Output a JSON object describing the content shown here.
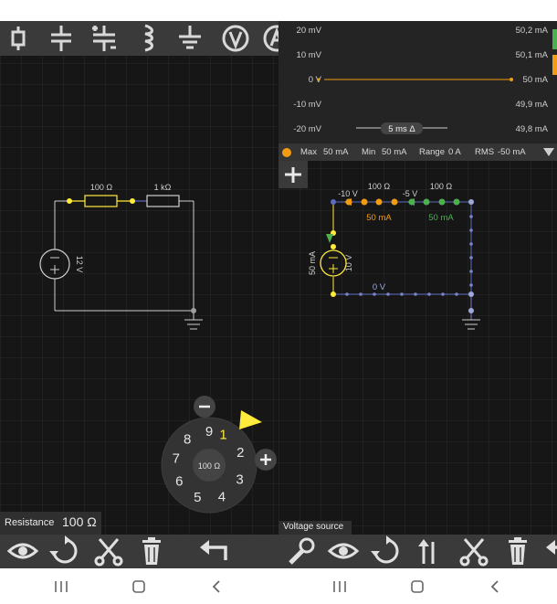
{
  "left": {
    "toolbar_icons": [
      "resistor-icon",
      "capacitor-icon",
      "polarized-capacitor-icon",
      "inductor-icon",
      "ground-icon",
      "voltmeter-icon",
      "ammeter-icon"
    ],
    "circuit": {
      "resistor1": "100 Ω",
      "resistor2": "1 kΩ",
      "source": "12 V"
    },
    "dial": {
      "digits": [
        "1",
        "2",
        "3",
        "4",
        "5",
        "6",
        "7",
        "8",
        "9"
      ],
      "center_value": "100 Ω",
      "selected_digit": "1"
    },
    "property": {
      "label": "Resistance",
      "value": "100 Ω"
    },
    "bottom_icons": [
      "eye-icon",
      "rotate-icon",
      "cut-icon",
      "trash-icon",
      "undo-icon"
    ]
  },
  "right": {
    "scope": {
      "rows": [
        {
          "v": "20 mV",
          "i": "50,2 mA"
        },
        {
          "v": "10 mV",
          "i": "50,1 mA"
        },
        {
          "v": "0 V",
          "i": "50 mA"
        },
        {
          "v": "-10 mV",
          "i": "49,9 mA"
        },
        {
          "v": "-20 mV",
          "i": "49,8 mA"
        }
      ],
      "timebase": "5 ms Δ",
      "stats": {
        "max_label": "Max",
        "max": "50 mA",
        "min_label": "Min",
        "min": "50 mA",
        "range_label": "Range",
        "range": "0 A",
        "rms_label": "RMS",
        "rms": "-50 mA"
      },
      "colors": {
        "voltage": "#4caf50",
        "current": "#f39c12"
      }
    },
    "circuit": {
      "v_left": "-10 V",
      "v_mid": "-5 V",
      "r1": "100 Ω",
      "r2": "100 Ω",
      "i1": "50 mA",
      "i2": "50 mA",
      "source_current": "50 mA",
      "source_voltage": "10 V",
      "v_bottom": "0 V"
    },
    "selection_label": "Voltage source",
    "bottom_icons": [
      "wrench-icon",
      "eye-icon",
      "rotate-icon",
      "flip-icon",
      "cut-icon",
      "trash-icon",
      "undo-icon"
    ]
  },
  "nav": [
    "recent-apps-icon",
    "home-icon",
    "back-icon"
  ]
}
